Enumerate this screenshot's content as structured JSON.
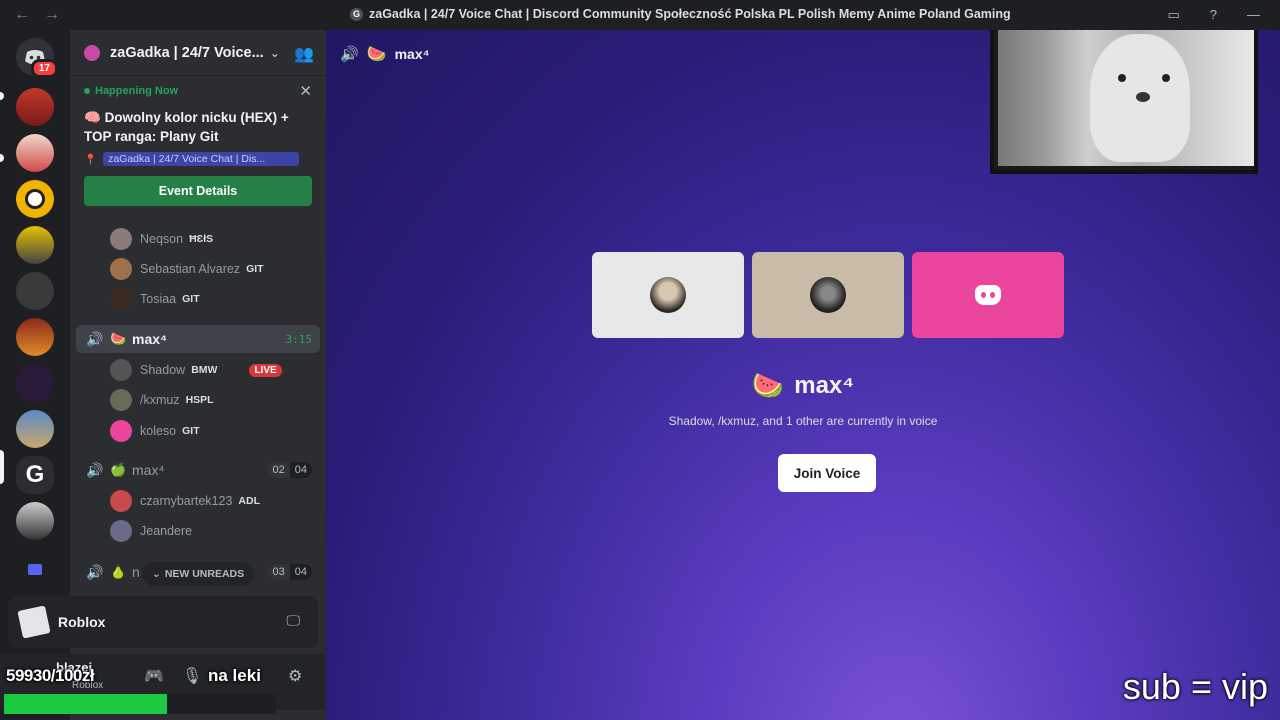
{
  "titlebar": {
    "title": "zaGadka | 24/7 Voice Chat | Discord Community Społeczność Polska PL Polish Memy Anime Poland Gaming",
    "server_initial": "G"
  },
  "servers": {
    "dm_badge": "17"
  },
  "guild": {
    "name": "zaGadka | 24/7 Voice..."
  },
  "event": {
    "happening_label": "Happening Now",
    "title": "Dowolny kolor nicku (HEX) + TOP ranga: Plany Git",
    "location": "zaGadka | 24/7 Voice Chat | Dis...",
    "button_label": "Event Details"
  },
  "channels": {
    "users_top": [
      {
        "name": "Neqson",
        "tag": "ĦƐłS"
      },
      {
        "name": "Sebastian Alvarez",
        "tag": "GIT"
      },
      {
        "name": "Tosiaa",
        "tag": "GIT"
      }
    ],
    "active": {
      "name": "max⁴",
      "timer": "3:15"
    },
    "active_users": [
      {
        "name": "Shadow",
        "tag": "BMW",
        "live": "LIVE"
      },
      {
        "name": "/kxmuz",
        "tag": "HSPL"
      },
      {
        "name": "koleso",
        "tag": "GIT"
      }
    ],
    "second": {
      "name": "max⁴",
      "count_current": "02",
      "count_max": "04"
    },
    "second_users": [
      {
        "name": "czarnybartek123",
        "tag": "ADL"
      },
      {
        "name": "Jeandere",
        "tag": ""
      }
    ],
    "third": {
      "name": "n",
      "count_current": "03",
      "count_max": "04"
    },
    "new_unreads": "NEW UNREADS"
  },
  "activity": {
    "name": "Roblox"
  },
  "userbar": {
    "username": "blazej",
    "status": "Roblox"
  },
  "overlay": {
    "counter": "59930/100zł",
    "naleki": "na leki",
    "sub_vip": "sub = vip",
    "progress_fraction": 0.5993
  },
  "main": {
    "header_channel": "max⁴",
    "voice_name": "max⁴",
    "voice_sub": "Shadow, /kxmuz, and 1 other are currently in voice",
    "join_label": "Join Voice"
  }
}
